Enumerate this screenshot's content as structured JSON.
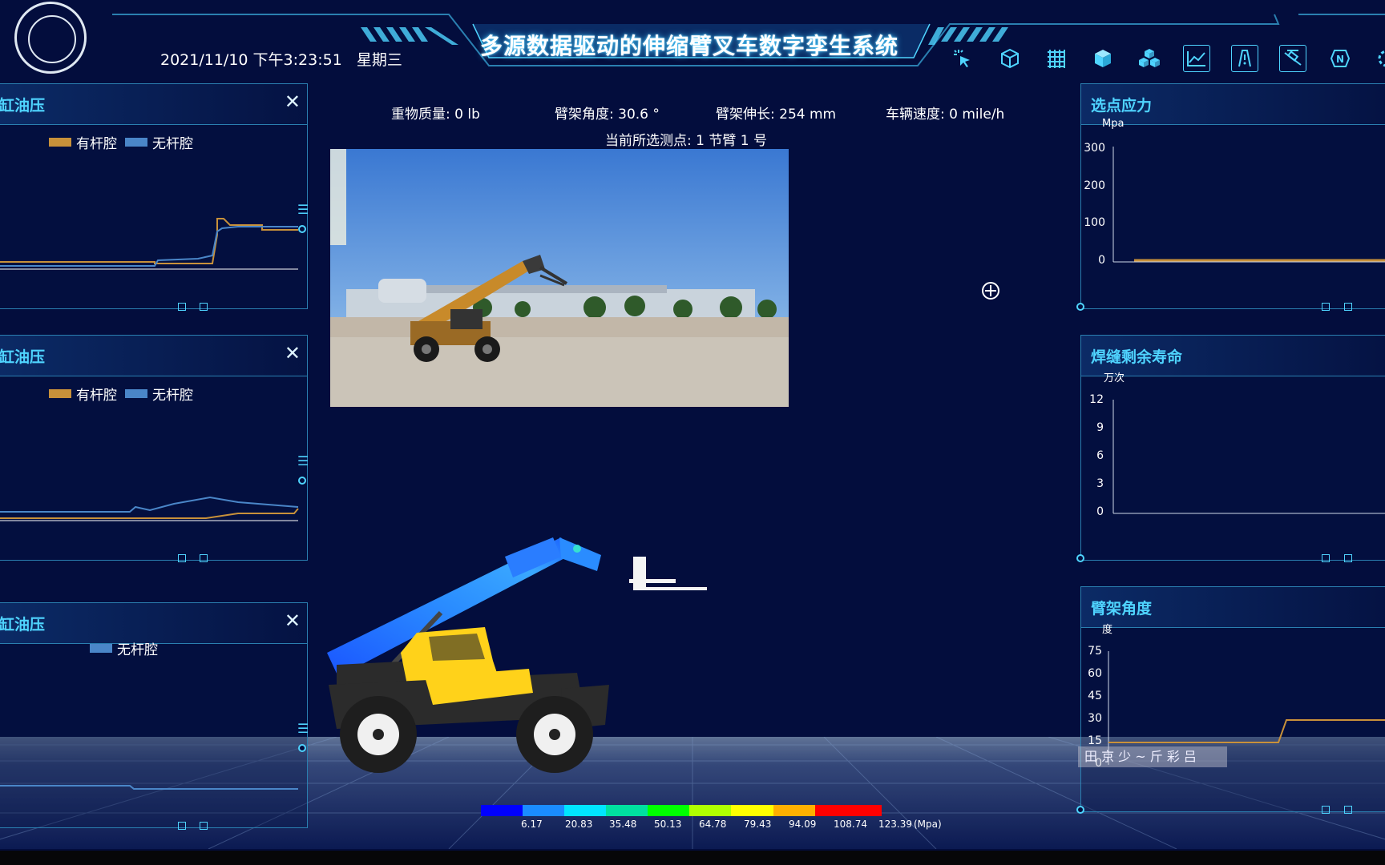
{
  "header": {
    "title": "多源数据驱动的伸缩臂叉车数字孪生系统",
    "datetime": "2021/11/10 下午3:23:51",
    "weekday": "星期三",
    "toolbar_icons": [
      "cursor-click-icon",
      "cube-outline-icon",
      "grid-icon",
      "cube-solid-icon",
      "cubes-icon",
      "line-chart-icon",
      "warning-icon",
      "ruler-icon",
      "compass-north-icon",
      "settings-icon"
    ]
  },
  "info": {
    "load_mass": "重物质量: 0 lb",
    "boom_angle": "臂架角度: 30.6 °",
    "boom_extension": "臂架伸长: 254 mm",
    "vehicle_speed": "车辆速度: 0 mile/h",
    "selected_point": "当前所选测点: 1 节臂 1 号"
  },
  "left_panels": [
    {
      "title": "缸油压",
      "legend": [
        "有杆腔",
        "无杆腔"
      ]
    },
    {
      "title": "缸油压",
      "legend": [
        "有杆腔",
        "无杆腔"
      ]
    },
    {
      "title": "缸油压",
      "legend": [
        "无杆腔"
      ]
    }
  ],
  "right_panels": {
    "stress": {
      "title": "选点应力",
      "unit": "Mpa",
      "ticks": [
        "300",
        "200",
        "100",
        "0"
      ]
    },
    "weld_life": {
      "title": "焊缝剩余寿命",
      "unit": "万次",
      "ticks": [
        "12",
        "9",
        "6",
        "3",
        "0"
      ]
    },
    "boom_angle": {
      "title": "臂架角度",
      "unit": "度",
      "ticks": [
        "75",
        "60",
        "45",
        "30",
        "15",
        "0"
      ]
    }
  },
  "colorbar": {
    "labels": [
      "6.17",
      "20.83",
      "35.48",
      "50.13",
      "64.78",
      "79.43",
      "94.09",
      "108.74",
      "123.39"
    ],
    "unit": "(Mpa)",
    "colors": [
      "#0000ff",
      "#1a8cff",
      "#00e5ff",
      "#00e0a0",
      "#00ff00",
      "#b0ff00",
      "#ffff00",
      "#ffb000",
      "#ff0000"
    ]
  },
  "colors": {
    "rod_chamber": "#c8913a",
    "rodless_chamber": "#4a86c8",
    "accent": "#4fd4ff"
  },
  "overlay_text": "田 京 少 ~ 斤 彩 吕"
}
